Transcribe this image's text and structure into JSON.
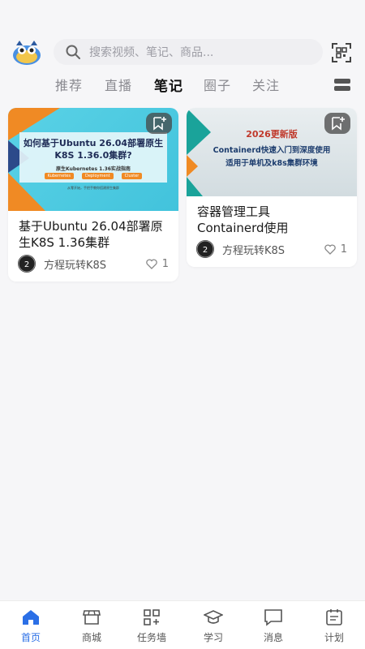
{
  "header": {
    "search_placeholder": "搜索视频、笔记、商品..."
  },
  "tabs": [
    {
      "label": "推荐",
      "active": false
    },
    {
      "label": "直播",
      "active": false
    },
    {
      "label": "笔记",
      "active": true
    },
    {
      "label": "圈子",
      "active": false
    },
    {
      "label": "关注",
      "active": false
    }
  ],
  "cards": [
    {
      "cover_title": "如何基于Ubuntu 26.04部署原生K8S 1.36.0集群?",
      "cover_subtitle": "原生Kubernetes 1.36实战指南",
      "cover_tags": [
        "Kubernetes",
        "Deployment",
        "Cluster"
      ],
      "cover_caption": "从零开始，手把手教你搭建原生集群",
      "title": "基于Ubuntu 26.04部署原生K8S 1.36集群",
      "author": "方程玩转K8S",
      "likes": "1"
    },
    {
      "cover_badge": "2026更新版",
      "cover_line1": "Containerd快速入门到深度使用",
      "cover_line2": "适用于单机及k8s集群环境",
      "title": "容器管理工具Containerd使用",
      "author": "方程玩转K8S",
      "likes": "1"
    }
  ],
  "bottom_nav": [
    {
      "label": "首页",
      "icon": "home-icon",
      "active": true
    },
    {
      "label": "商城",
      "icon": "shop-icon",
      "active": false
    },
    {
      "label": "任务墙",
      "icon": "task-wall-icon",
      "active": false
    },
    {
      "label": "学习",
      "icon": "graduation-cap-icon",
      "active": false
    },
    {
      "label": "消息",
      "icon": "message-icon",
      "active": false
    },
    {
      "label": "计划",
      "icon": "plan-icon",
      "active": false
    }
  ],
  "colors": {
    "accent": "#2b6fe6",
    "background": "#f6f6f8"
  }
}
